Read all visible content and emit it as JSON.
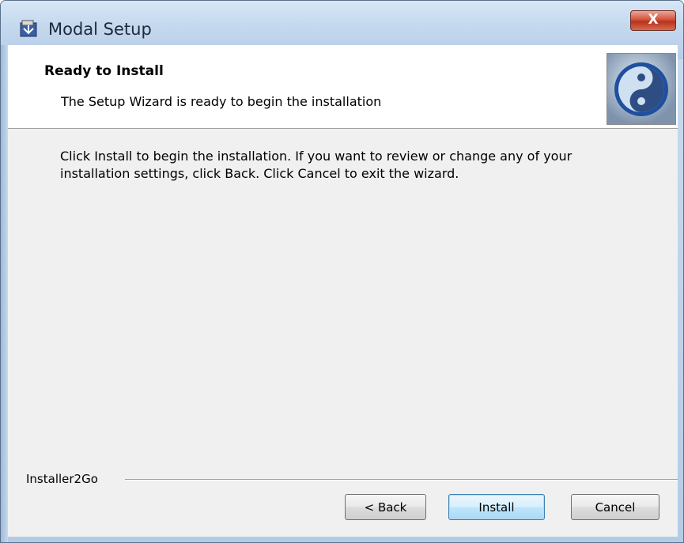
{
  "window": {
    "title": "Modal Setup",
    "close_label": "X"
  },
  "banner": {
    "title": "Ready to Install",
    "subtitle": "The Setup Wizard is ready to begin the installation"
  },
  "body": {
    "instructions": "Click Install to begin the installation.  If you want to review or change any of your installation settings, click Back.  Click Cancel to exit the wizard."
  },
  "footer": {
    "brand": "Installer2Go",
    "back_label": "< Back",
    "install_label": "Install",
    "cancel_label": "Cancel"
  },
  "icons": {
    "app": "installer-package-icon",
    "logo": "yin-yang-logo-icon",
    "close": "close-icon"
  },
  "colors": {
    "titlebar": "#c4d8ee",
    "close_button": "#d2533b",
    "default_button_border": "#3c7fb1",
    "client_background": "#f0f0f0"
  }
}
